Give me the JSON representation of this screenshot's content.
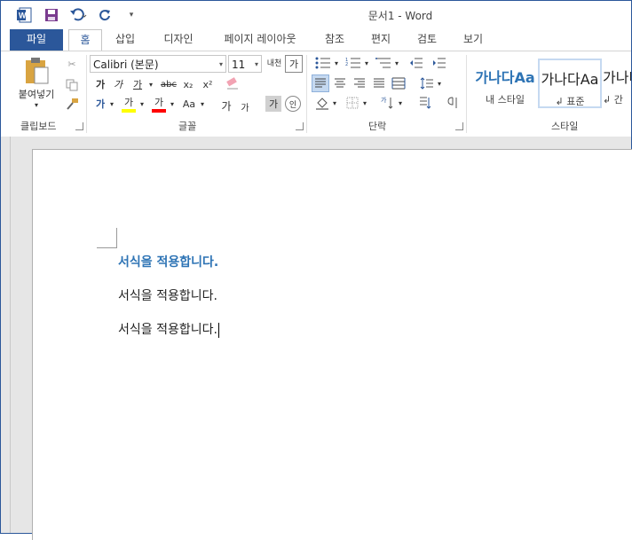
{
  "window": {
    "title": "문서1 - Word"
  },
  "tabs": [
    "파일",
    "홈",
    "삽입",
    "디자인",
    "페이지 레이아웃",
    "참조",
    "편지",
    "검토",
    "보기"
  ],
  "ribbon": {
    "clipboard": {
      "paste_label": "붙여넣기",
      "group_label": "클립보드"
    },
    "font": {
      "font_name": "Calibri (본문)",
      "font_size": "11",
      "group_label": "글꼴",
      "bold": "가",
      "italic": "가",
      "underline": "가",
      "strike": "abc",
      "subscript": "x₂",
      "superscript": "x²",
      "text_effect": "가",
      "highlight": "가",
      "font_color": "가",
      "change_case": "Aa",
      "grow": "가",
      "shrink": "가",
      "char_shade": "가",
      "enclose": "인",
      "phonetic": "내천",
      "clear_fmt": "가"
    },
    "paragraph": {
      "group_label": "단락"
    },
    "styles": {
      "group_label": "스타일",
      "items": [
        {
          "sample": "가나다Aa",
          "name": "내 스타일"
        },
        {
          "sample": "가나다Aa",
          "name": "↲ 표준"
        },
        {
          "sample": "가나다",
          "name": "↲ 간격"
        }
      ]
    }
  },
  "document": {
    "paragraphs": [
      "서식을 적용합니다.",
      "서식을 적용합니다.",
      "서식을 적용합니다."
    ]
  },
  "colors": {
    "accent": "#2b579a",
    "heading": "#2e74b5",
    "highlight": "#ffff00",
    "font_color": "#ff0000"
  }
}
